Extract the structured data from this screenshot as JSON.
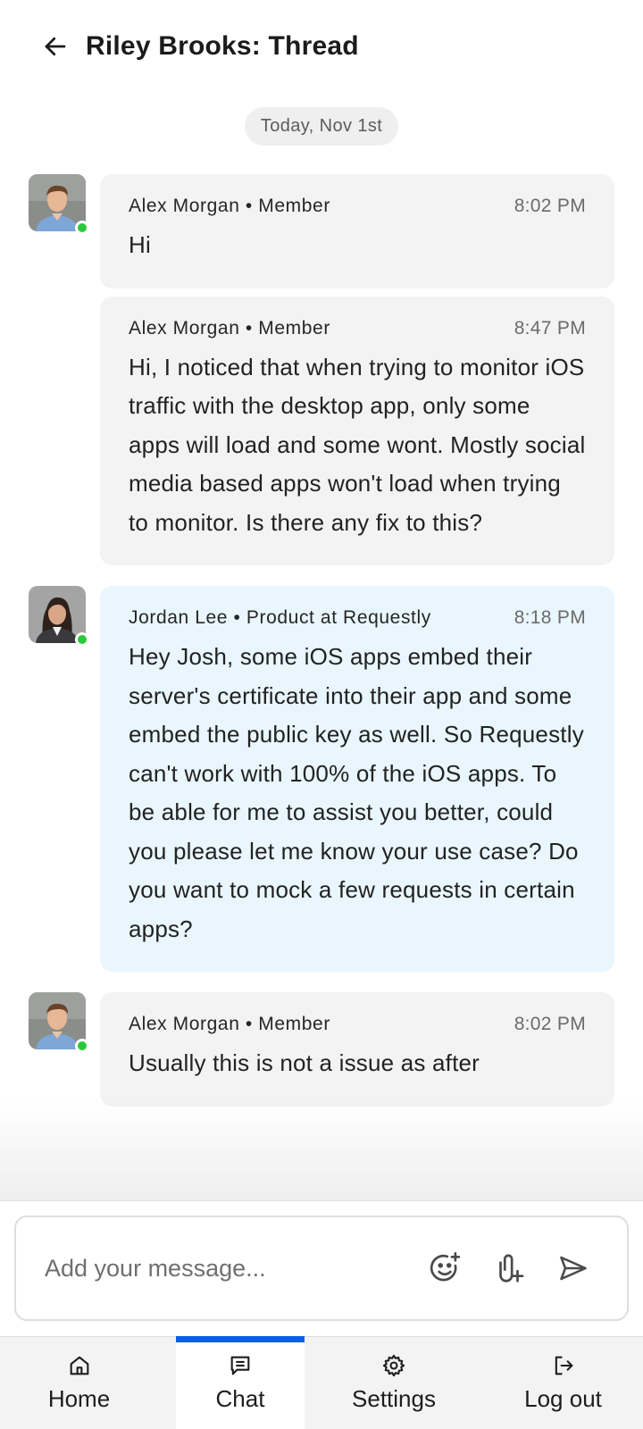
{
  "header": {
    "title": "Riley Brooks: Thread"
  },
  "date_divider": "Today, Nov 1st",
  "messages": [
    {
      "author": "Alex Morgan • Member",
      "time": "8:02 PM",
      "text": "Hi",
      "avatar": "male-avatar",
      "online": true
    },
    {
      "author": "Alex Morgan • Member",
      "time": "8:47 PM",
      "text": "Hi, I noticed that when trying to monitor iOS traffic with the desktop app, only some apps will load and some wont. Mostly social media based apps won't load when trying to monitor. Is there any fix to this?"
    },
    {
      "author": "Jordan Lee • Product at Requestly",
      "time": "8:18 PM",
      "text": "Hey Josh, some iOS apps embed their server's certificate into their app and some embed the public key as well. So Requestly can't work with 100% of the iOS apps. To be able for me to assist you better, could you please let me know your use case? Do you want to mock a few requests in certain apps?",
      "avatar": "female-avatar",
      "online": true
    },
    {
      "author": "Alex Morgan • Member",
      "time": "8:02 PM",
      "text": "Usually this is not a issue as after",
      "avatar": "male-avatar",
      "online": true
    }
  ],
  "composer": {
    "placeholder": "Add your message...",
    "icons": [
      "emoji-add-icon",
      "attachment-add-icon",
      "send-icon"
    ]
  },
  "tabs": [
    {
      "label": "Home",
      "icon": "home-icon"
    },
    {
      "label": "Chat",
      "icon": "chat-icon",
      "active": true
    },
    {
      "label": "Settings",
      "icon": "gear-icon"
    },
    {
      "label": "Log out",
      "icon": "logout-icon"
    }
  ],
  "colors": {
    "accent": "#0a5fe8",
    "online": "#2bc83c",
    "member_bubble": "#f3f3f3",
    "staff_bubble": "#e9f6fd"
  }
}
